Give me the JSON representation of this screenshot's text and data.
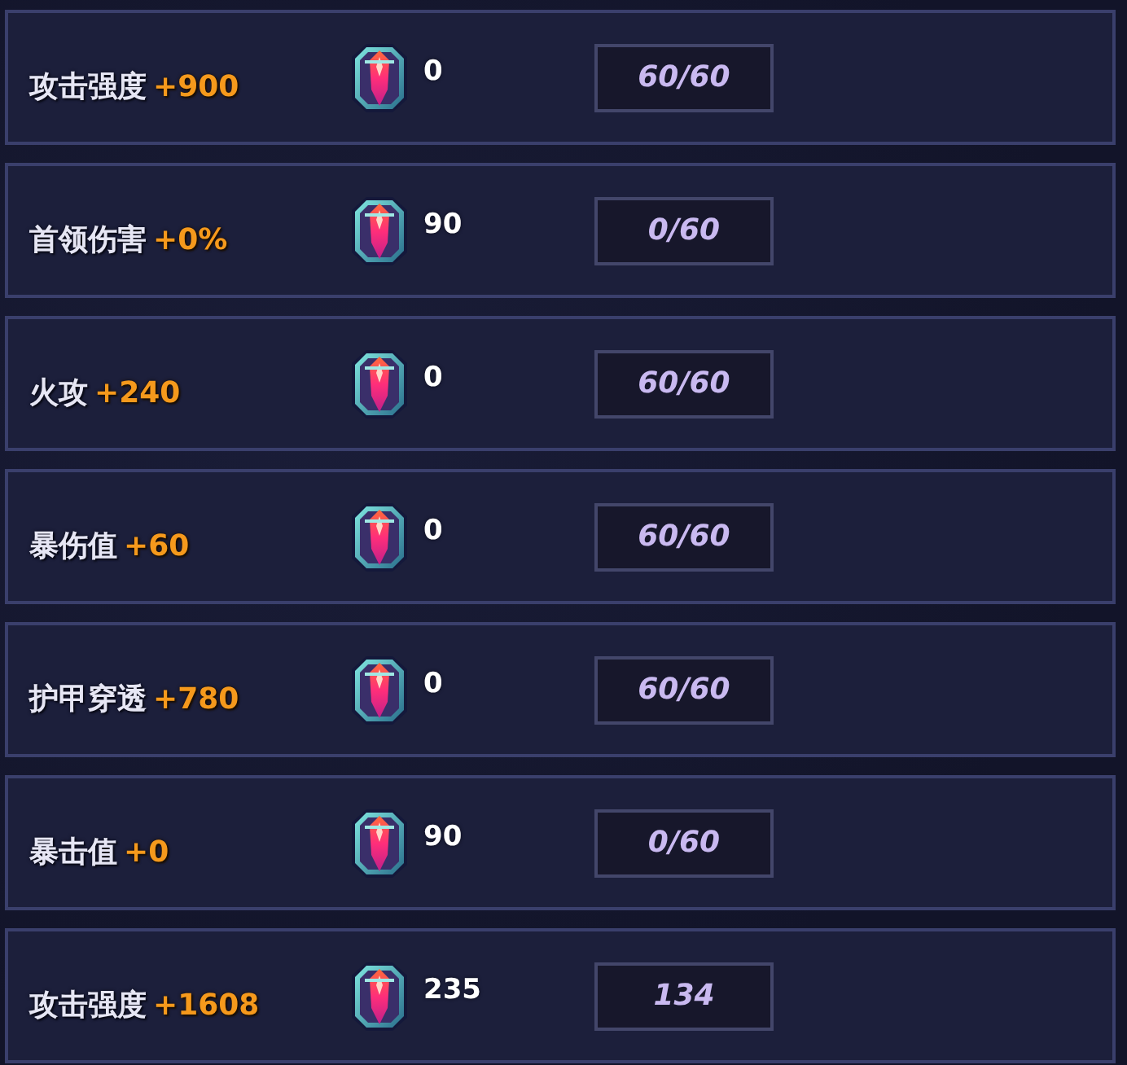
{
  "rows": [
    {
      "label": "攻击强度",
      "bonus": "+900",
      "gem_count": "0",
      "progress": "60/60"
    },
    {
      "label": "首领伤害",
      "bonus": "+0%",
      "gem_count": "90",
      "progress": "0/60"
    },
    {
      "label": "火攻",
      "bonus": "+240",
      "gem_count": "0",
      "progress": "60/60"
    },
    {
      "label": "暴伤值",
      "bonus": "+60",
      "gem_count": "0",
      "progress": "60/60"
    },
    {
      "label": "护甲穿透",
      "bonus": "+780",
      "gem_count": "0",
      "progress": "60/60"
    },
    {
      "label": "暴击值",
      "bonus": "+0",
      "gem_count": "90",
      "progress": "0/60"
    },
    {
      "label": "攻击强度",
      "bonus": "+1608",
      "gem_count": "235",
      "progress": "134"
    }
  ]
}
